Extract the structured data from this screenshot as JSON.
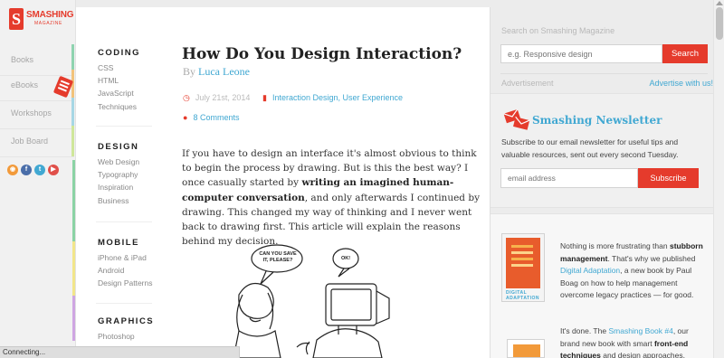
{
  "logo": {
    "word1": "SMASHING",
    "word2": "MAGAZINE"
  },
  "nav": [
    {
      "label": "Books",
      "color": "#8fd4b0"
    },
    {
      "label": "eBooks",
      "color": "#f2c37b"
    },
    {
      "label": "Workshops",
      "color": "#a7d7e5"
    },
    {
      "label": "Job Board",
      "color": "#cfe79a"
    }
  ],
  "social": [
    {
      "icon": "rss-icon",
      "glyph": "◉",
      "color": "#f29a3a"
    },
    {
      "icon": "facebook-icon",
      "glyph": "f",
      "color": "#4a6ea9"
    },
    {
      "icon": "twitter-icon",
      "glyph": "t",
      "color": "#41a8d2"
    },
    {
      "icon": "youtube-icon",
      "glyph": "▶",
      "color": "#e0504a"
    }
  ],
  "status": "Connecting...",
  "categories": {
    "coding": {
      "title": "CODING",
      "items": [
        "CSS",
        "HTML",
        "JavaScript",
        "Techniques"
      ]
    },
    "design": {
      "title": "DESIGN",
      "items": [
        "Web Design",
        "Typography",
        "Inspiration",
        "Business"
      ]
    },
    "mobile": {
      "title": "MOBILE",
      "items": [
        "iPhone & iPad",
        "Android",
        "Design Patterns"
      ]
    },
    "graphics": {
      "title": "GRAPHICS",
      "items": [
        "Photoshop"
      ]
    }
  },
  "article": {
    "title": "How Do You Design Interaction?",
    "by": "By",
    "author": "Luca Leone",
    "date": "July 21st, 2014",
    "tags": "Interaction Design, User Experience",
    "comments": "8 Comments",
    "p1": "If you have to design an interface it's almost obvious to think to begin the process by drawing. But is this the best way? I once casually started by",
    "p_bold": "writing an imagined human-computer conversation",
    "p2": ", and only afterwards I continued by drawing. This changed my way of thinking and I never went back to drawing first. This article will explain the reasons behind my decision.",
    "bubble1": "CAN YOU SAVE IT, PLEASE?",
    "bubble2": "OK!"
  },
  "sidebar": {
    "search_label": "Search on Smashing Magazine",
    "search_placeholder": "e.g. Responsive design",
    "search_button": "Search",
    "advert_label": "Advertisement",
    "advertise_link": "Advertise with us!",
    "newsletter_title": "Smashing Newsletter",
    "newsletter_text": "Subscribe to our email newsletter for useful tips and valuable resources, sent out every second Tuesday.",
    "email_placeholder": "email address",
    "subscribe_button": "Subscribe",
    "book1_title": "DIGITAL ADAPTATION",
    "promo1": {
      "a": "Nothing is more frustrating than",
      "b": "stubborn management",
      "c": ". That's why we published",
      "link": "Digital Adaptation",
      "d": ", a new book by Paul Boag on how to help management overcome legacy practices — for good."
    },
    "promo2": {
      "a": "It's done. The",
      "link": "Smashing Book #4",
      "b": ", our brand new book with smart",
      "c": "front-end techniques",
      "d": "and design approaches."
    }
  },
  "colors": {
    "accent": "#e53b2c",
    "link": "#41a8d2"
  }
}
